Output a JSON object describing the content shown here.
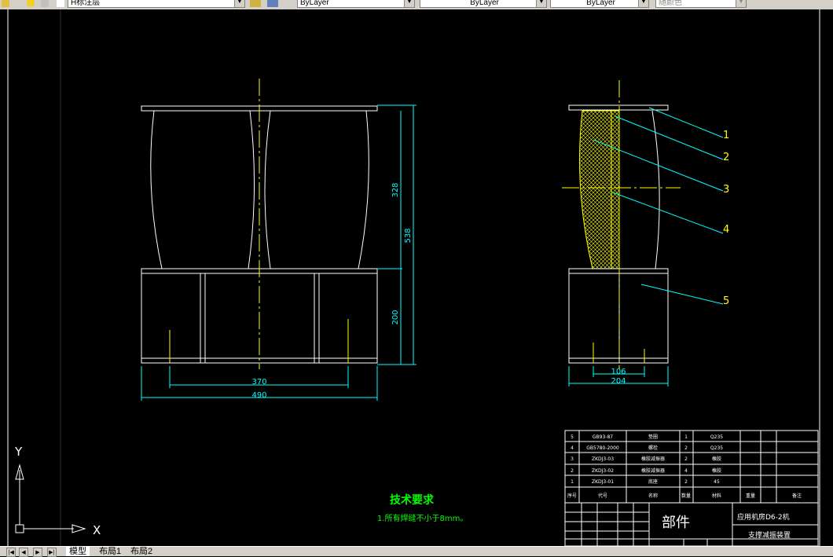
{
  "toolbar": {
    "layer_name": "H标注层",
    "color": "ByLayer",
    "linetype": "ByLayer",
    "lineweight": "ByLayer",
    "plot_style": "随颜色"
  },
  "drawing": {
    "front_view_dims": {
      "upper_height": "328",
      "total_height": "538",
      "lower_height": "200",
      "inner_width": "370",
      "outer_width": "490"
    },
    "side_view_dims": {
      "inner_width": "106",
      "outer_width": "204"
    },
    "balloons": [
      "1",
      "2",
      "3",
      "4",
      "5"
    ],
    "tech_requirements": {
      "title": "技术要求",
      "line1": "1.所有焊缝不小于8mm。"
    },
    "ucs": {
      "x_label": "X",
      "y_label": "Y"
    }
  },
  "bom": {
    "rows": [
      {
        "no": "5",
        "code": "GB93-87",
        "name": "垫圈",
        "qty": "1",
        "material": "Q235"
      },
      {
        "no": "4",
        "code": "GB5780-2000",
        "name": "螺栓",
        "qty": "2",
        "material": "Q235"
      },
      {
        "no": "3",
        "code": "ZKDJ3-03",
        "name": "橡胶减振器",
        "qty": "2",
        "material": "橡胶"
      },
      {
        "no": "2",
        "code": "ZKDJ3-02",
        "name": "橡胶减振器",
        "qty": "4",
        "material": "橡胶"
      },
      {
        "no": "1",
        "code": "ZKDJ3-01",
        "name": "底座",
        "qty": "2",
        "material": "45"
      }
    ],
    "headers": {
      "no": "序号",
      "code": "代号",
      "name": "名称",
      "qty": "数量",
      "material": "材料",
      "weight": "重量",
      "note": "备注"
    },
    "part_label": "部件",
    "machine": "应用机房D6-2机",
    "title": "支撑减振装置"
  },
  "tabs": {
    "model": "模型",
    "layout1": "布局1",
    "layout2": "布局2"
  }
}
